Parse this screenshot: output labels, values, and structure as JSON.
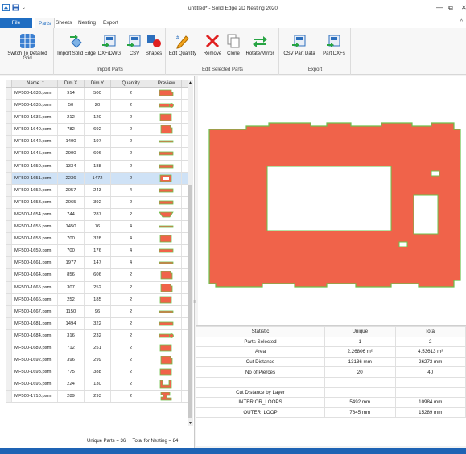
{
  "window": {
    "title": "untitled* - Solid Edge 2D Nesting 2020",
    "minimize": "—",
    "restore": "⧉",
    "close": "✕"
  },
  "tabs": [
    {
      "label": "File"
    },
    {
      "label": "Parts"
    },
    {
      "label": "Sheets"
    },
    {
      "label": "Nesting"
    },
    {
      "label": "Export"
    }
  ],
  "ribbon": {
    "switch_view": "Switch To Detailed Grid",
    "import_parts": {
      "label": "Import Parts",
      "buttons": [
        "Import Solid Edge",
        "DXF/DWG",
        "CSV",
        "Shapes"
      ]
    },
    "edit_parts": {
      "label": "Edit Selected Parts",
      "buttons": [
        "Edit Quantity",
        "Remove",
        "Clone",
        "Rotate/Mirror"
      ]
    },
    "export": {
      "label": "Export",
      "buttons": [
        "CSV Part Data",
        "Part DXFs"
      ]
    },
    "colors": {
      "accent": "#1f6dc2",
      "remove_red": "#e02020",
      "green": "#23a83a"
    }
  },
  "grid": {
    "columns": [
      "Name",
      "Dim X",
      "Dim Y",
      "Quantity",
      "Preview"
    ],
    "rows": [
      {
        "name": "MF500-1633.psm",
        "x": "914",
        "y": "500",
        "q": "2",
        "shape": "wide"
      },
      {
        "name": "MF500-1635.psm",
        "x": "50",
        "y": "20",
        "q": "2",
        "shape": "tab"
      },
      {
        "name": "MF500-1636.psm",
        "x": "212",
        "y": "120",
        "q": "2",
        "shape": "plate"
      },
      {
        "name": "MF500-1640.psm",
        "x": "782",
        "y": "692",
        "q": "2",
        "shape": "square"
      },
      {
        "name": "MF500-1642.psm",
        "x": "1400",
        "y": "197",
        "q": "2",
        "shape": "strip"
      },
      {
        "name": "MF500-1645.psm",
        "x": "2900",
        "y": "606",
        "q": "2",
        "shape": "bar"
      },
      {
        "name": "MF500-1650.psm",
        "x": "1334",
        "y": "188",
        "q": "2",
        "shape": "bar"
      },
      {
        "name": "MF500-1651.psm",
        "x": "2236",
        "y": "1472",
        "q": "2",
        "shape": "frame",
        "selected": true
      },
      {
        "name": "MF500-1652.psm",
        "x": "2057",
        "y": "243",
        "q": "4",
        "shape": "bar"
      },
      {
        "name": "MF500-1653.psm",
        "x": "2065",
        "y": "392",
        "q": "2",
        "shape": "bar"
      },
      {
        "name": "MF500-1654.psm",
        "x": "744",
        "y": "287",
        "q": "2",
        "shape": "chevron"
      },
      {
        "name": "MF500-1655.psm",
        "x": "1450",
        "y": "76",
        "q": "4",
        "shape": "strip"
      },
      {
        "name": "MF500-1658.psm",
        "x": "700",
        "y": "328",
        "q": "4",
        "shape": "plate"
      },
      {
        "name": "MF500-1659.psm",
        "x": "700",
        "y": "176",
        "q": "4",
        "shape": "bar"
      },
      {
        "name": "MF500-1661.psm",
        "x": "1977",
        "y": "147",
        "q": "4",
        "shape": "strip"
      },
      {
        "name": "MF500-1664.psm",
        "x": "856",
        "y": "606",
        "q": "2",
        "shape": "square"
      },
      {
        "name": "MF500-1665.psm",
        "x": "307",
        "y": "252",
        "q": "2",
        "shape": "square"
      },
      {
        "name": "MF500-1666.psm",
        "x": "252",
        "y": "185",
        "q": "2",
        "shape": "plate"
      },
      {
        "name": "MF500-1667.psm",
        "x": "1150",
        "y": "96",
        "q": "2",
        "shape": "strip"
      },
      {
        "name": "MF500-1681.psm",
        "x": "1494",
        "y": "322",
        "q": "2",
        "shape": "bar"
      },
      {
        "name": "MF500-1684.psm",
        "x": "316",
        "y": "232",
        "q": "2",
        "shape": "tab"
      },
      {
        "name": "MF500-1689.psm",
        "x": "712",
        "y": "251",
        "q": "2",
        "shape": "plate"
      },
      {
        "name": "MF500-1692.psm",
        "x": "396",
        "y": "299",
        "q": "2",
        "shape": "square"
      },
      {
        "name": "MF500-1693.psm",
        "x": "775",
        "y": "388",
        "q": "2",
        "shape": "plate"
      },
      {
        "name": "MF500-1696.psm",
        "x": "224",
        "y": "130",
        "q": "2",
        "shape": "ushape"
      },
      {
        "name": "MF500-1710.psm",
        "x": "289",
        "y": "293",
        "q": "2",
        "shape": "bracket"
      }
    ]
  },
  "summary": {
    "unique_label": "Unique Parts = 36",
    "total_label": "Total for Nesting = 84"
  },
  "preview": {
    "fill": "#f0634a",
    "outline": "#6cc04a",
    "hole": "#ffffff"
  },
  "stats": {
    "headers": [
      "Statistic",
      "Unique",
      "Total"
    ],
    "rows": [
      [
        "Parts Selected",
        "1",
        "2"
      ],
      [
        "Area",
        "2.26806 m²",
        "4.53613 m²"
      ],
      [
        "Cut Distance",
        "13136 mm",
        "26273 mm"
      ],
      [
        "No of Pierces",
        "20",
        "40"
      ],
      [
        "",
        "",
        ""
      ],
      [
        "Cut Distance by Layer",
        "",
        ""
      ],
      [
        "INTERIOR_LOOPS",
        "5492 mm",
        "10984 mm"
      ],
      [
        "OUTER_LOOP",
        "7645 mm",
        "15289 mm"
      ]
    ]
  }
}
